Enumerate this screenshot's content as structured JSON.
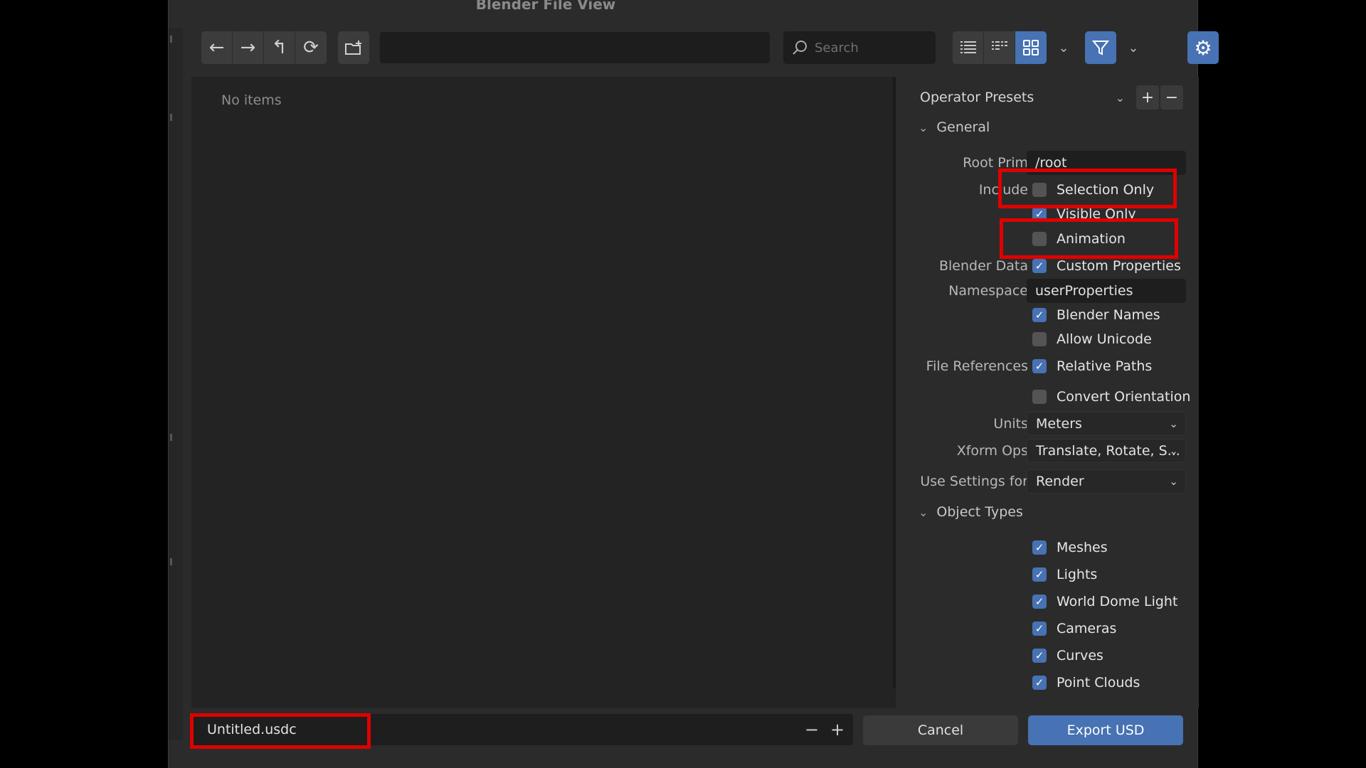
{
  "window": {
    "title": "Blender File View"
  },
  "toolbar": {
    "back_icon": "arrow-left",
    "forward_icon": "arrow-right",
    "parent_icon": "arrow-up",
    "refresh_icon": "refresh",
    "new_folder_icon": "new-folder",
    "search_placeholder": "Search",
    "path_value": "",
    "display_modes": [
      "vertical-list",
      "horizontal-list",
      "thumbnails"
    ],
    "active_display_mode": "thumbnails",
    "filter_active": true,
    "accent_color": "#4772b3"
  },
  "file_list": {
    "empty_text": "No items"
  },
  "sidebar": {
    "presets_label": "Operator Presets",
    "general_label": "General",
    "root_prim_label": "Root Prim",
    "root_prim_value": "/root",
    "include_label": "Include",
    "selection_only_label": "Selection Only",
    "selection_only_checked": false,
    "visible_only_label": "Visible Only",
    "visible_only_checked": true,
    "animation_label": "Animation",
    "animation_checked": false,
    "blender_data_label": "Blender Data",
    "custom_properties_label": "Custom Properties",
    "custom_properties_checked": true,
    "namespace_label": "Namespace",
    "namespace_value": "userProperties",
    "blender_names_label": "Blender Names",
    "blender_names_checked": true,
    "allow_unicode_label": "Allow Unicode",
    "allow_unicode_checked": false,
    "file_references_label": "File References",
    "relative_paths_label": "Relative Paths",
    "relative_paths_checked": true,
    "convert_orientation_label": "Convert Orientation",
    "convert_orientation_checked": false,
    "units_label": "Units",
    "units_value": "Meters",
    "xform_ops_label": "Xform Ops",
    "xform_ops_value": "Translate, Rotate, S...",
    "use_settings_label": "Use Settings for",
    "use_settings_value": "Render",
    "object_types_label": "Object Types",
    "object_types": [
      {
        "label": "Meshes",
        "checked": true
      },
      {
        "label": "Lights",
        "checked": true
      },
      {
        "label": "World Dome Light",
        "checked": true
      },
      {
        "label": "Cameras",
        "checked": true
      },
      {
        "label": "Curves",
        "checked": true
      },
      {
        "label": "Point Clouds",
        "checked": true
      }
    ]
  },
  "footer": {
    "filename_value": "Untitled.usdc",
    "cancel_label": "Cancel",
    "export_label": "Export USD"
  },
  "highlight_color": "#e00000"
}
